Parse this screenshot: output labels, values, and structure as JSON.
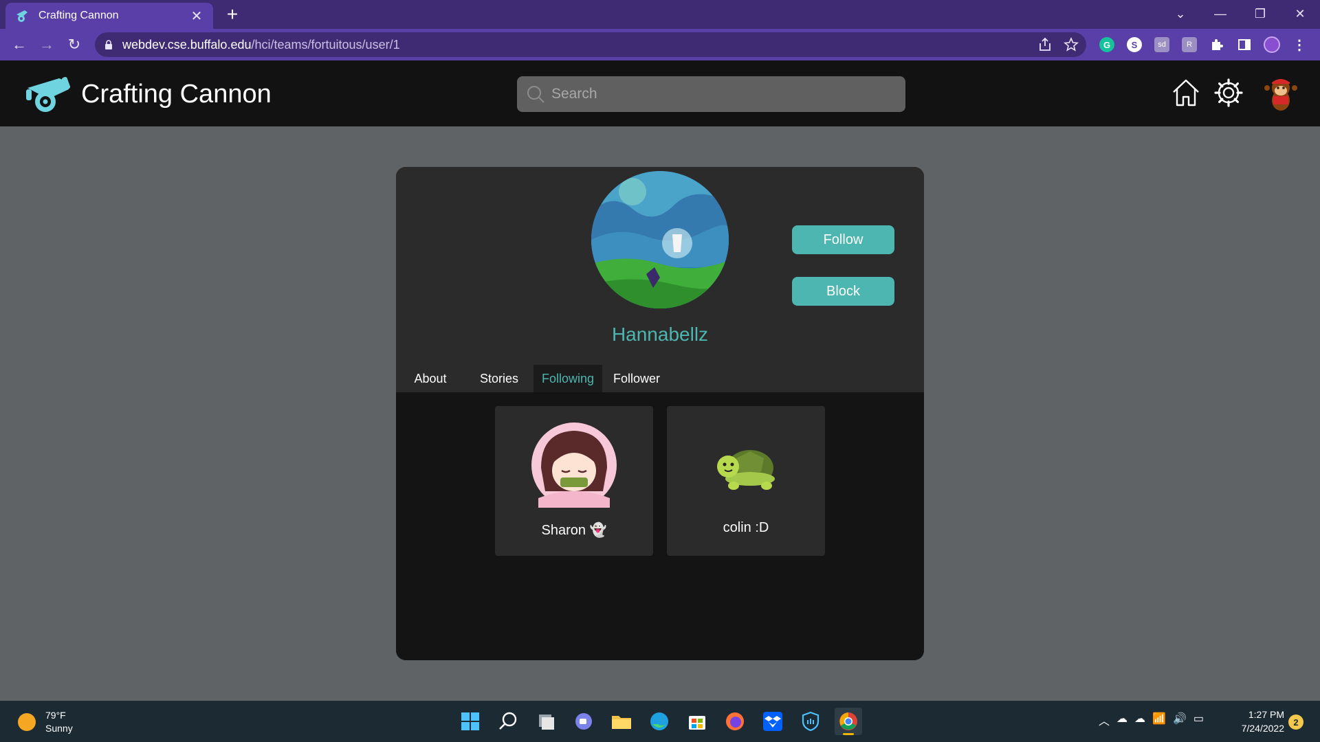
{
  "browser": {
    "tab_title": "Crafting Cannon",
    "tab_close": "✕",
    "new_tab": "+",
    "url_host": "webdev.cse.buffalo.edu",
    "url_path": "/hci/teams/fortuitous/user/1",
    "window_controls": {
      "dropdown": "⌄",
      "minimize": "—",
      "restore": "❐",
      "close": "✕"
    },
    "nav": {
      "back": "←",
      "forward": "→",
      "reload": "↻"
    }
  },
  "header": {
    "brand": "Crafting Cannon",
    "search_placeholder": "Search"
  },
  "profile": {
    "username": "Hannabellz",
    "follow_label": "Follow",
    "block_label": "Block",
    "tabs": [
      "About",
      "Stories",
      "Following",
      "Follower"
    ],
    "active_tab": "Following",
    "following": [
      {
        "name": "Sharon 👻"
      },
      {
        "name": "colin :D"
      }
    ]
  },
  "taskbar": {
    "temperature": "79°F",
    "condition": "Sunny",
    "time": "1:27 PM",
    "date": "7/24/2022",
    "notification_count": "2"
  },
  "colors": {
    "accent": "#4db6b0",
    "browser_purple": "#5a3fa8",
    "header_bg": "#121212"
  }
}
